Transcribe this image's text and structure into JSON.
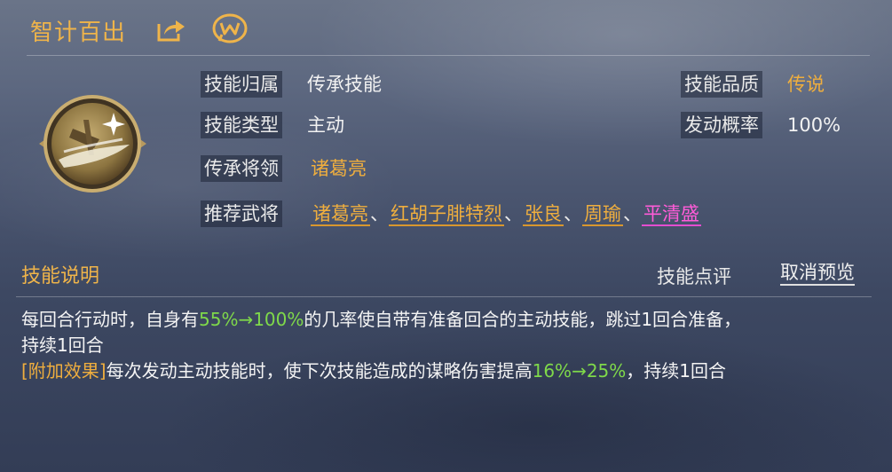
{
  "header": {
    "title": "智计百出"
  },
  "info": {
    "attribution_label": "技能归属",
    "attribution_value": "传承技能",
    "quality_label": "技能品质",
    "quality_value": "传说",
    "type_label": "技能类型",
    "type_value": "主动",
    "chance_label": "发动概率",
    "chance_value": "100%",
    "inherit_label": "传承将领",
    "inherit_value": "诸葛亮",
    "recommend_label": "推荐武将"
  },
  "recommended": [
    {
      "name": "诸葛亮",
      "color": "#efae3e"
    },
    {
      "name": "红胡子腓特烈",
      "color": "#efae3e"
    },
    {
      "name": "张良",
      "color": "#efae3e"
    },
    {
      "name": "周瑜",
      "color": "#efae3e"
    },
    {
      "name": "平清盛",
      "color": "#ff5cd8"
    }
  ],
  "recommended_separator": "、",
  "section": {
    "title": "技能说明",
    "rate_button": "技能点评",
    "cancel_preview_button": "取消预览"
  },
  "description": {
    "line1_a": "每回合行动时，自身有",
    "line1_pct": "55%→100%",
    "line1_b": "的几率使自带有准备回合的主动技能，跳过1回合准备，",
    "line2": "持续1回合",
    "extra_tag": "[附加效果]",
    "extra_a": "每次发动主动技能时，使下次技能造成的谋略伤害提高",
    "extra_pct": "16%→25%",
    "extra_b": "，持续1回合"
  },
  "colors": {
    "gold": "#efae3e",
    "green": "#7fd94a",
    "pink": "#ff5cd8"
  },
  "icons": [
    "share-icon",
    "wechat-w-icon",
    "skill-emblem-icon"
  ]
}
